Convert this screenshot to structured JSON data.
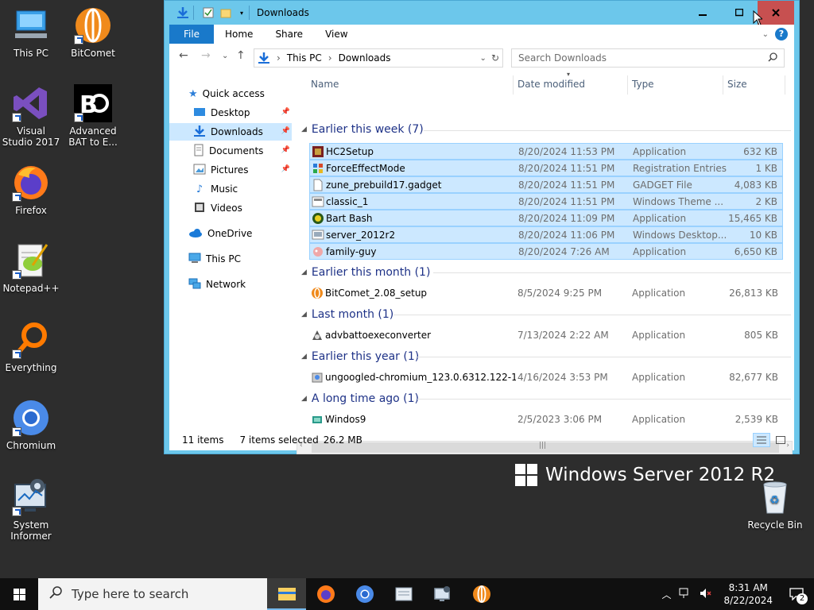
{
  "desktop": {
    "icons": [
      {
        "label": "This PC"
      },
      {
        "label": "BitComet"
      },
      {
        "label": "Visual Studio 2017"
      },
      {
        "label": "Advanced BAT to E..."
      },
      {
        "label": "Firefox"
      },
      {
        "label": "Notepad++"
      },
      {
        "label": "Everything"
      },
      {
        "label": "Chromium"
      },
      {
        "label": "System Informer"
      },
      {
        "label": "Recycle Bin"
      }
    ],
    "watermark": "Windows Server 2012 R2"
  },
  "window": {
    "title": "Downloads",
    "controls": {
      "minimize": "—",
      "maximize": "☐",
      "close": "✕"
    },
    "ribbon_tabs": [
      "File",
      "Home",
      "Share",
      "View"
    ],
    "help": "?",
    "breadcrumb": [
      "This PC",
      "Downloads"
    ],
    "search_placeholder": "Search Downloads",
    "nav": {
      "quick_access": "Quick access",
      "items": [
        "Desktop",
        "Downloads",
        "Documents",
        "Pictures",
        "Music",
        "Videos"
      ],
      "onedrive": "OneDrive",
      "this_pc": "This PC",
      "network": "Network"
    },
    "columns": [
      "Name",
      "Date modified",
      "Type",
      "Size"
    ],
    "groups": [
      {
        "label": "Earlier this week (7)",
        "files": [
          {
            "name": "HC2Setup",
            "date": "8/20/2024 11:53 PM",
            "type": "Application",
            "size": "632 KB",
            "selected": true
          },
          {
            "name": "ForceEffectMode",
            "date": "8/20/2024 11:51 PM",
            "type": "Registration Entries",
            "size": "1 KB",
            "selected": true
          },
          {
            "name": "zune_prebuild17.gadget",
            "date": "8/20/2024 11:51 PM",
            "type": "GADGET File",
            "size": "4,083 KB",
            "selected": true
          },
          {
            "name": "classic_1",
            "date": "8/20/2024 11:51 PM",
            "type": "Windows Theme ...",
            "size": "2 KB",
            "selected": true
          },
          {
            "name": "Bart Bash",
            "date": "8/20/2024 11:09 PM",
            "type": "Application",
            "size": "15,465 KB",
            "selected": true
          },
          {
            "name": "server_2012r2",
            "date": "8/20/2024 11:06 PM",
            "type": "Windows Desktop...",
            "size": "10 KB",
            "selected": true
          },
          {
            "name": "family-guy",
            "date": "8/20/2024 7:26 AM",
            "type": "Application",
            "size": "6,650 KB",
            "selected": true
          }
        ]
      },
      {
        "label": "Earlier this month (1)",
        "files": [
          {
            "name": "BitComet_2.08_setup",
            "date": "8/5/2024 9:25 PM",
            "type": "Application",
            "size": "26,813 KB",
            "selected": false
          }
        ]
      },
      {
        "label": "Last month (1)",
        "files": [
          {
            "name": "advbattoexeconverter",
            "date": "7/13/2024 2:22 AM",
            "type": "Application",
            "size": "805 KB",
            "selected": false
          }
        ]
      },
      {
        "label": "Earlier this year (1)",
        "files": [
          {
            "name": "ungoogled-chromium_123.0.6312.122-1....",
            "date": "4/16/2024 3:53 PM",
            "type": "Application",
            "size": "82,677 KB",
            "selected": false
          }
        ]
      },
      {
        "label": "A long time ago (1)",
        "files": [
          {
            "name": "Windos9",
            "date": "2/5/2023 3:06 PM",
            "type": "Application",
            "size": "2,539 KB",
            "selected": false
          }
        ]
      }
    ],
    "status": {
      "count": "11 items",
      "selected": "7 items selected",
      "size": "26.2 MB"
    }
  },
  "taskbar": {
    "search_placeholder": "Type here to search",
    "time": "8:31 AM",
    "date": "8/22/2024",
    "notifications": "2"
  }
}
